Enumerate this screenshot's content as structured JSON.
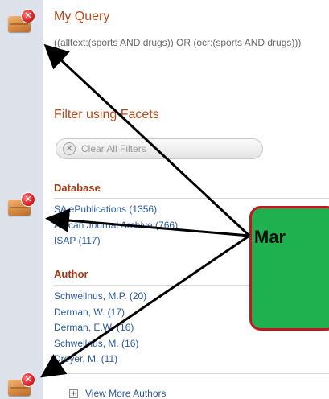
{
  "rail": {
    "buttons": [
      {
        "icon": "remove-query-icon",
        "glyph": "✕"
      },
      {
        "icon": "remove-database-filter-icon",
        "glyph": "✕"
      },
      {
        "icon": "remove-author-filter-icon",
        "glyph": "✕"
      }
    ]
  },
  "query": {
    "title": "My Query",
    "text": "((alltext:(sports AND drugs)) OR (ocr:(sports AND drugs)))"
  },
  "facets": {
    "title": "Filter using Facets",
    "clear_label": "Clear All Filters",
    "clear_icon": "clear-x-icon"
  },
  "database": {
    "heading": "Database",
    "items": [
      "SA ePublications (1356)",
      "African Journal Archive (766)",
      "ISAP (117)"
    ]
  },
  "author": {
    "heading": "Author",
    "items": [
      "Schwellnus, M.P. (20)",
      "Derman, W. (17)",
      "Derman, E.W. (16)",
      "Schwellnus, M. (16)",
      "Dreyer, M. (11)"
    ],
    "view_more": "View More Authors"
  },
  "callout": {
    "text": "Mar",
    "fill": "#1fb14f",
    "border": "#c2171e"
  },
  "colors": {
    "heading": "#b94a1a",
    "link": "#2c5aa0",
    "rail": "#dde1ea"
  }
}
